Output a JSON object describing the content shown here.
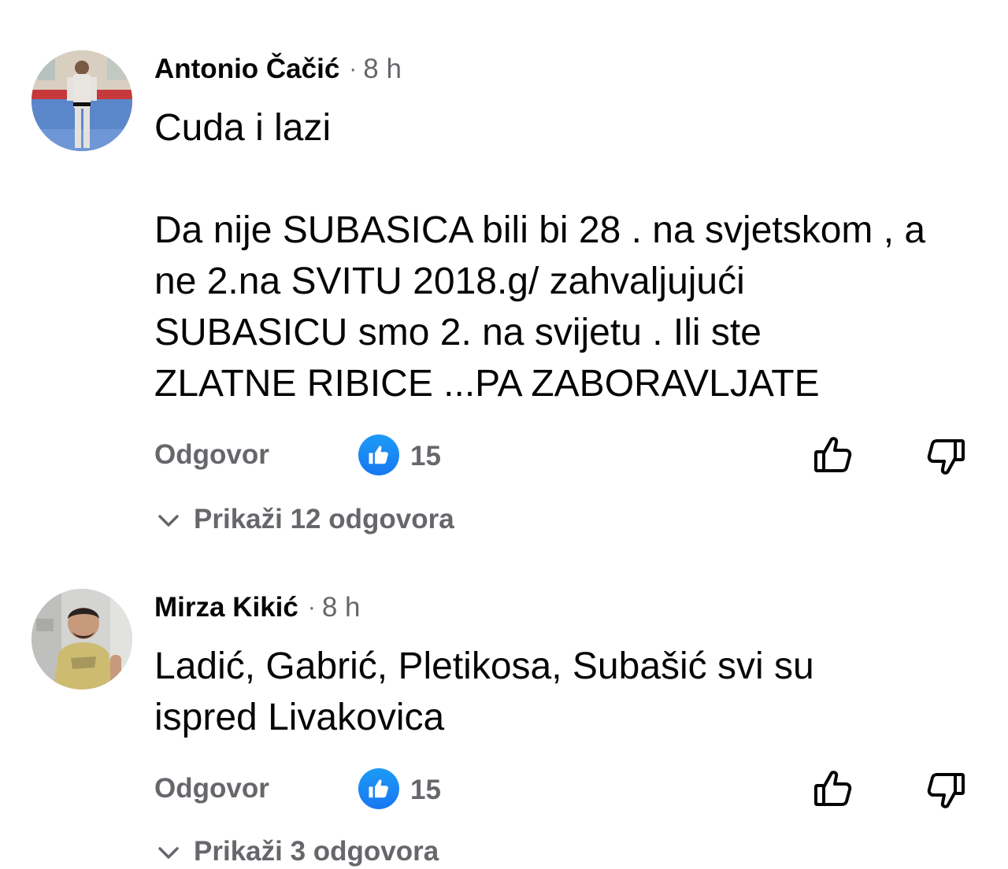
{
  "comments": [
    {
      "author": "Antonio Čačić",
      "separator": "·",
      "time": "8 h",
      "avatar": "avatar-photo-martial-arts-dojo",
      "paragraphs": [
        [
          "Cuda i lazi"
        ],
        [
          "Da nije SUBASICA bili bi 28 . na svjetskom  , a",
          "ne 2.na SVITU 2018.g/ zahvaljujući",
          "SUBASICU smo 2.  na svijetu .    Ili ste",
          "ZLATNE RIBICE ...PA ZABORAVLJATE"
        ]
      ],
      "reply_label": "Odgovor",
      "reaction_icon": "like-icon",
      "reaction_count": "15",
      "like_button_icon": "thumbs-up-icon",
      "dislike_button_icon": "thumbs-down-icon",
      "replies_label": "Prikaži 12 odgovora"
    },
    {
      "author": "Mirza Kikić",
      "separator": "·",
      "time": "8 h",
      "avatar": "avatar-photo-man-yellow-shirt",
      "paragraphs": [
        [
          "Ladić, Gabrić, Pletikosa, Subašić svi su",
          "ispred Livakovica"
        ]
      ],
      "reply_label": "Odgovor",
      "reaction_icon": "like-icon",
      "reaction_count": "15",
      "like_button_icon": "thumbs-up-icon",
      "dislike_button_icon": "thumbs-down-icon",
      "replies_label": "Prikaži 3 odgovora"
    }
  ],
  "colors": {
    "text_primary": "#050505",
    "text_secondary": "#65676b",
    "like_blue": "#1877f2",
    "background": "#ffffff"
  }
}
